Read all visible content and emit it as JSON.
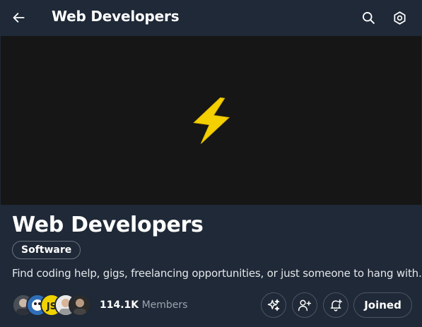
{
  "header": {
    "title": "Web Developers",
    "back_icon": "arrow-left-icon",
    "search_icon": "search-icon",
    "settings_icon": "gear-icon"
  },
  "banner": {
    "icon": "lightning-bolt-icon",
    "background": "#161616",
    "icon_color": "#f5d000"
  },
  "community": {
    "title": "Web Developers",
    "category": "Software",
    "description": "Find coding help, gigs, freelancing opportunities, or just someone to hang with.",
    "members_count": "114.1K",
    "members_label": "Members"
  },
  "actions": {
    "explore_icon": "sparkle-icon",
    "invite_icon": "add-person-icon",
    "notify_icon": "bell-add-icon",
    "joined_label": "Joined"
  },
  "colors": {
    "background": "#1f2937",
    "text": "#ffffff",
    "muted": "#9ca3af",
    "border": "#4b5563"
  }
}
